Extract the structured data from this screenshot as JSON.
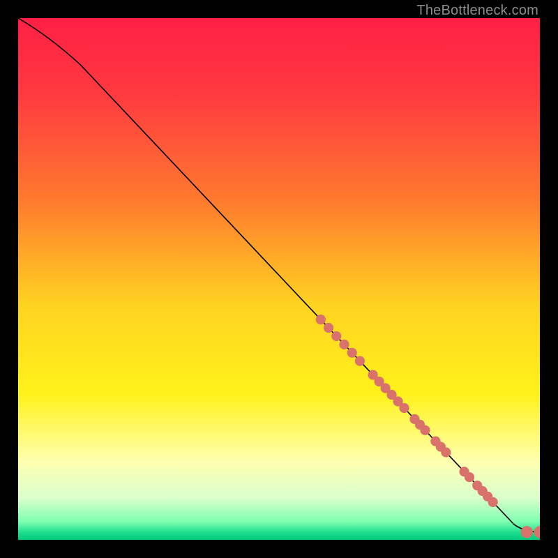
{
  "watermark": "TheBottleneck.com",
  "chart_data": {
    "type": "line",
    "title": "",
    "xlabel": "",
    "ylabel": "",
    "xlim": [
      0,
      100
    ],
    "ylim": [
      0,
      100
    ],
    "grid": false,
    "legend": false,
    "background_gradient_stops": [
      {
        "offset": 0.0,
        "color": "#ff1f45"
      },
      {
        "offset": 0.15,
        "color": "#ff3b3f"
      },
      {
        "offset": 0.35,
        "color": "#ff7a2e"
      },
      {
        "offset": 0.55,
        "color": "#ffd321"
      },
      {
        "offset": 0.72,
        "color": "#fff21a"
      },
      {
        "offset": 0.85,
        "color": "#ffffb0"
      },
      {
        "offset": 0.92,
        "color": "#d9ffcc"
      },
      {
        "offset": 0.965,
        "color": "#7fffb0"
      },
      {
        "offset": 0.985,
        "color": "#20e08f"
      },
      {
        "offset": 1.0,
        "color": "#00c97a"
      }
    ],
    "series": [
      {
        "name": "bottleneck-curve",
        "color": "#000000",
        "points": [
          {
            "x": 0,
            "y": 100
          },
          {
            "x": 6,
            "y": 96.5
          },
          {
            "x": 12,
            "y": 91
          },
          {
            "x": 95,
            "y": 3
          },
          {
            "x": 97,
            "y": 1.5
          },
          {
            "x": 100,
            "y": 1.5
          }
        ]
      }
    ],
    "markers": {
      "color": "#d9726b",
      "radius_small": 6,
      "radius_large": 8,
      "points_on_curve_x": [
        58,
        59.5,
        61,
        62.5,
        64,
        65.5,
        68,
        69.2,
        70.4,
        71.6,
        72.8,
        74,
        76,
        77,
        78,
        80,
        81,
        82,
        85.5,
        86.5,
        88,
        89,
        90,
        91
      ],
      "tail_points": [
        {
          "x": 97.5,
          "y": 1.5
        },
        {
          "x": 100,
          "y": 1.5
        }
      ]
    }
  }
}
